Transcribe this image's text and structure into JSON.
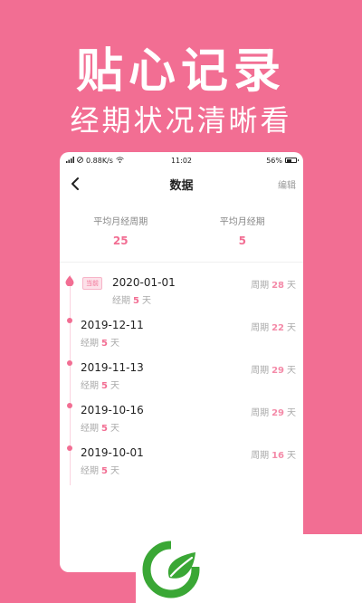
{
  "promo": {
    "title": "贴心记录",
    "subtitle": "经期状况清晰看"
  },
  "status_bar": {
    "network": "0.88K/s",
    "time": "11:02",
    "battery": "56%"
  },
  "nav": {
    "title": "数据",
    "edit_label": "编辑"
  },
  "stats": {
    "avg_cycle_label": "平均月经周期",
    "avg_cycle_value": "25",
    "avg_period_label": "平均月经期",
    "avg_period_value": "5"
  },
  "records": [
    {
      "date": "2020-01-01",
      "badge": "当前",
      "period_label": "经期",
      "period_days": "5",
      "cycle_label": "周期",
      "cycle_days": "28",
      "unit": "天"
    },
    {
      "date": "2019-12-11",
      "period_label": "经期",
      "period_days": "5",
      "cycle_label": "周期",
      "cycle_days": "22",
      "unit": "天"
    },
    {
      "date": "2019-11-13",
      "period_label": "经期",
      "period_days": "5",
      "cycle_label": "周期",
      "cycle_days": "29",
      "unit": "天"
    },
    {
      "date": "2019-10-16",
      "period_label": "经期",
      "period_days": "5",
      "cycle_label": "周期",
      "cycle_days": "29",
      "unit": "天"
    },
    {
      "date": "2019-10-01",
      "period_label": "经期",
      "period_days": "5",
      "cycle_label": "周期",
      "cycle_days": "16",
      "unit": "天"
    }
  ],
  "colors": {
    "accent": "#f26e93",
    "logo_green": "#3aa735"
  },
  "icons": {
    "back": "back-arrow-icon",
    "current_marker": "drop-icon",
    "logo": "leaf-logo-icon"
  }
}
